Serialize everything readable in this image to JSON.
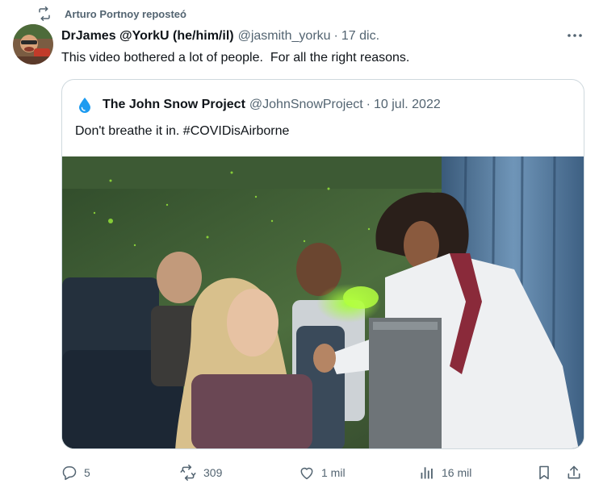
{
  "repost": {
    "icon": "repost-icon",
    "label": "Arturo Portnoy reposteó"
  },
  "tweet": {
    "author_name": "DrJames @YorkU (he/him/il)",
    "handle": "@jasmith_yorku",
    "separator": "·",
    "date": "17 dic.",
    "text": "This video bothered a lot of people.  For all the right reasons.",
    "more_icon": "more-icon"
  },
  "quote": {
    "account_icon": "water-drop-icon",
    "author_name": "The John Snow Project",
    "handle": "@JohnSnowProject",
    "separator": "·",
    "date": "10 jul. 2022",
    "text_prefix": "Don't breathe it in. ",
    "hashtag": "#COVIDisAirborne"
  },
  "actions": {
    "replies": "5",
    "reposts": "309",
    "likes": "1 mil",
    "views": "16 mil"
  },
  "colors": {
    "text": "#0f1419",
    "secondary": "#536471",
    "border": "#cfd9de",
    "drop": "#1d9bf0"
  }
}
